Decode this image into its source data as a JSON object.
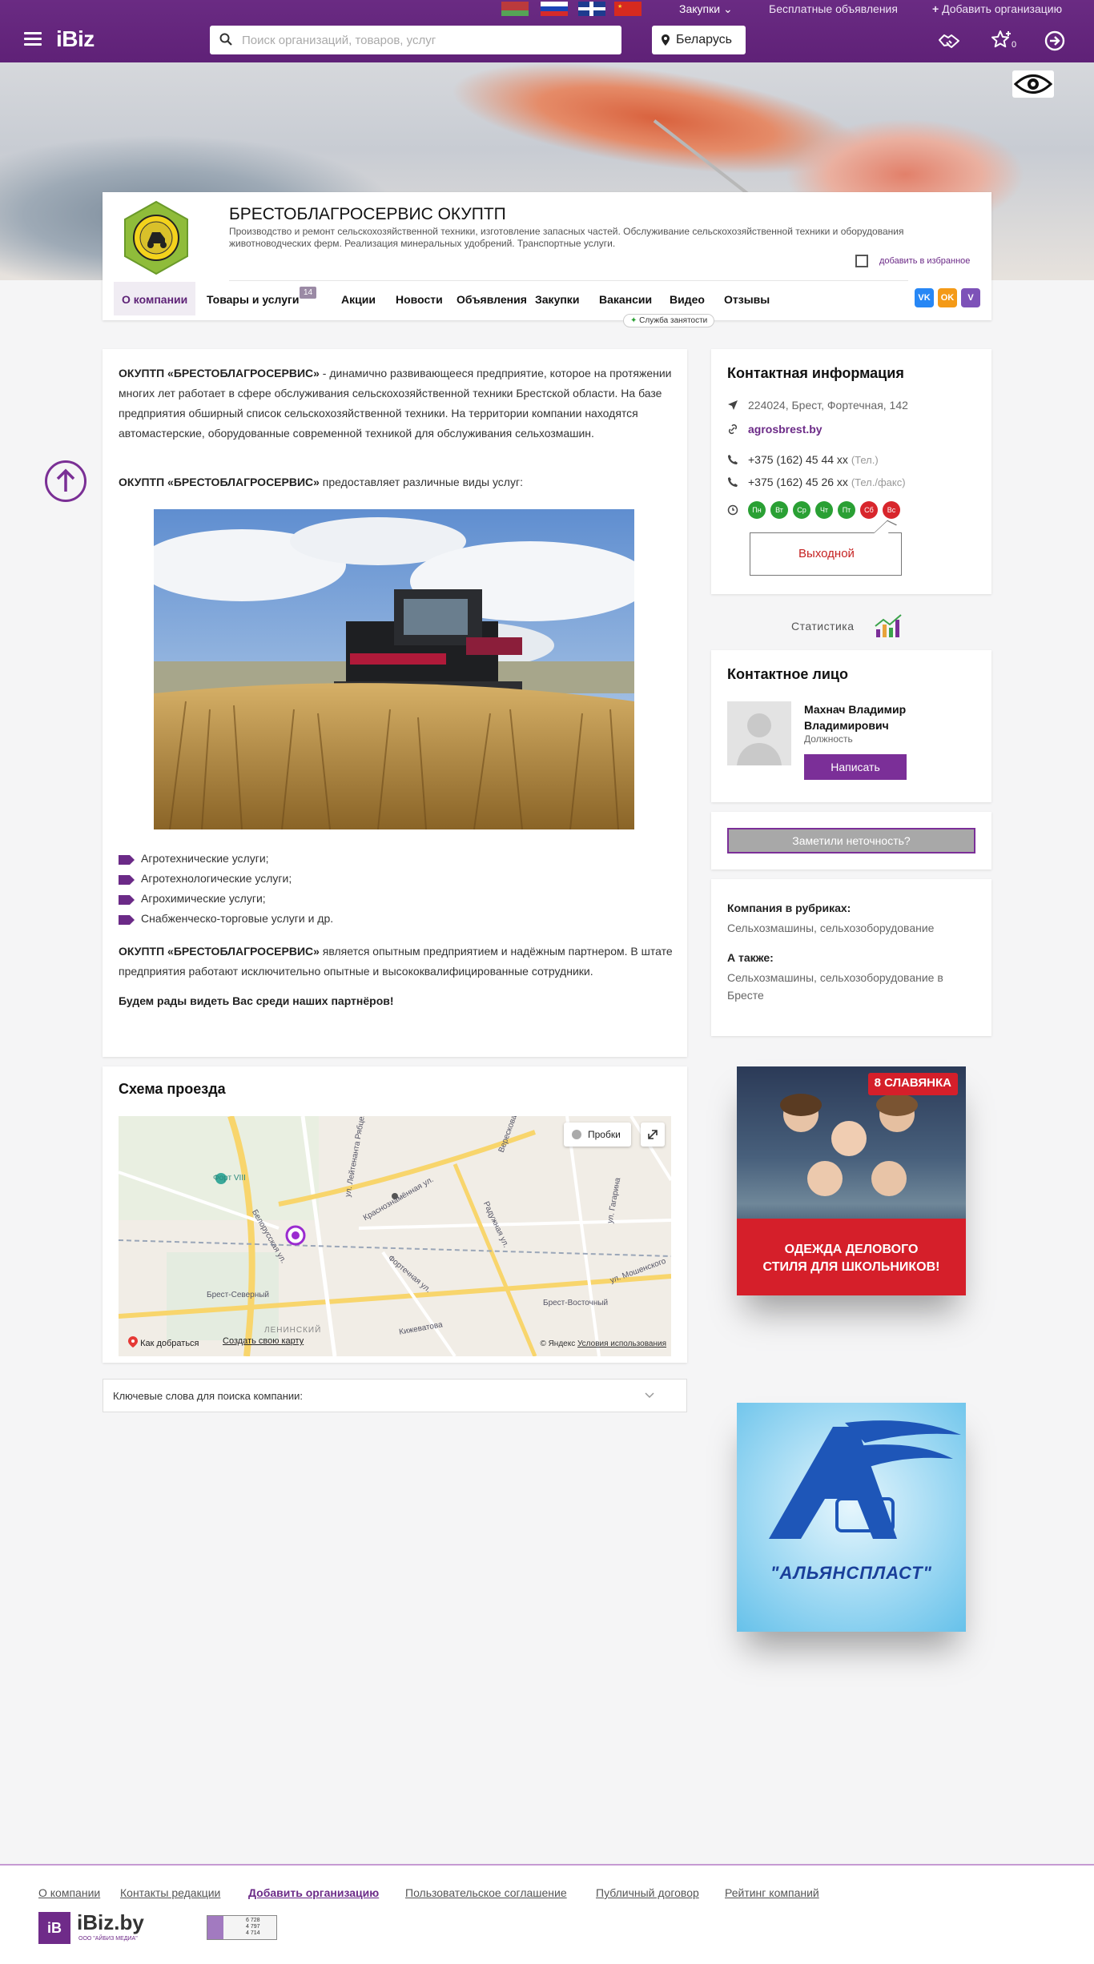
{
  "header": {
    "logo": "iBiz",
    "subnav": {
      "zakupki": "Закупки",
      "free_ads": "Бесплатные объявления",
      "add_org": "Добавить организацию"
    },
    "search_placeholder": "Поиск организаций, товаров, услуг",
    "country": "Беларусь",
    "favorites_count": "0"
  },
  "company": {
    "name": "БРЕСТОБЛАГРОСЕРВИС ОКУПТП",
    "description": "Производство и ремонт сельскохозяйственной техники, изготовление запасных частей. Обслуживание сельскохозяйственной техники и оборудования животноводческих ферм. Реализация минеральных удобрений. Транспортные услуги.",
    "favorite_label": "добавить в избранное",
    "tabs": [
      {
        "label": "О компании"
      },
      {
        "label": "Товары и услуги",
        "badge": "14"
      },
      {
        "label": "Акции"
      },
      {
        "label": "Новости"
      },
      {
        "label": "Объявления"
      },
      {
        "label": "Закупки"
      },
      {
        "label": "Вакансии"
      },
      {
        "label": "Видео"
      },
      {
        "label": "Отзывы"
      }
    ],
    "job_service": "Служба занятости",
    "social": {
      "vk": "VK",
      "ok": "OK",
      "viber": "V"
    }
  },
  "about": {
    "p1_bold": "ОКУПТП «БРЕСТОБЛАГРОСЕРВИС»",
    "p1_rest": " - динамично развивающееся предприятие, которое на протяжении многих лет работает в сфере обслуживания сельскохозяйственной техники Брестской области. На базе предприятия обширный список сельскохозяйственной техники. На территории компании находятся автомастерские, оборудованные современной техникой для обслуживания сельхозмашин.",
    "p2_bold": "ОКУПТП «БРЕСТОБЛАГРОСЕРВИС»",
    "p2_rest": " предоставляет различные виды услуг:",
    "services": [
      "Агротехнические услуги;",
      "Агротехнологические услуги;",
      "Агрохимические услуги;",
      "Снабженческо-торговые услуги и др."
    ],
    "p3_bold": "ОКУПТП «БРЕСТОБЛАГРОСЕРВИС»",
    "p3_rest": " является опытным предприятием и надёжным партнером. В штате предприятия работают исключительно опытные и высококвалифицированные сотрудники.",
    "p4": "Будем рады видеть Вас среди наших партнёров!"
  },
  "map": {
    "title": "Схема проезда",
    "traffic": "Пробки",
    "route": "Как добраться",
    "create_map": "Создать свою карту",
    "copyright": "© Яндекс",
    "terms": "Условия использования",
    "labels": [
      "Форт VIII",
      "Брест-Северный",
      "Брест-Восточный",
      "ЛЕНИНСКИЙ",
      "ул. Лейтенанта Рябцева",
      "Белорусская ул.",
      "Радужная ул.",
      "Фортечная ул.",
      "ул. Гагарина",
      "Кижеватова",
      "ул. Мошенского",
      "Краснознамённая ул.",
      "Вересковая"
    ]
  },
  "keywords": {
    "label": "Ключевые слова для поиска компании:"
  },
  "contacts": {
    "title": "Контактная информация",
    "address": "224024, Брест, Фортечная, 142",
    "site": "agrosbrest.by",
    "phone1": "+375 (162) 45 44 xx",
    "phone1_note": "(Тел.)",
    "phone2": "+375 (162) 45 26 xx",
    "phone2_note": "(Тел./факс)",
    "days": [
      {
        "d": "Пн",
        "open": true
      },
      {
        "d": "Вт",
        "open": true
      },
      {
        "d": "Ср",
        "open": true
      },
      {
        "d": "Чт",
        "open": true
      },
      {
        "d": "Пт",
        "open": true
      },
      {
        "d": "Сб",
        "open": false
      },
      {
        "d": "Вс",
        "open": false
      }
    ],
    "status": "Выходной"
  },
  "stats": {
    "label": "Статистика"
  },
  "person": {
    "title": "Контактное лицо",
    "name": "Махнач Владимир Владимирович",
    "role": "Должность",
    "write": "Написать"
  },
  "report": {
    "label": "Заметили неточность?"
  },
  "categories": {
    "heading": "Компания в рубриках:",
    "main": "Сельхозмашины, сельхозоборудование",
    "also_heading": "А также:",
    "also": "Сельхозмашины, сельхозоборудование в Бресте"
  },
  "ads": {
    "ad1_brand": "СЛАВЯНКА",
    "ad1_brand_num": "8",
    "ad1_line1": "ОДЕЖДА ДЕЛОВОГО",
    "ad1_line2": "СТИЛЯ ДЛЯ ШКОЛЬНИКОВ!",
    "ad2_name": "\"АЛЬЯНСПЛАСТ\""
  },
  "footer": {
    "links": [
      {
        "label": "О компании"
      },
      {
        "label": "Контакты редакции"
      },
      {
        "label": "Добавить организацию",
        "strong": true
      },
      {
        "label": "Пользовательское соглашение"
      },
      {
        "label": "Публичный договор"
      },
      {
        "label": "Рейтинг компаний"
      }
    ],
    "logo_mark": "iB",
    "logo_name": "iBiz.by",
    "logo_sub": "ООО \"АЙБИЗ МЕДИА\"",
    "counter": [
      "6 728",
      "4 797",
      "4 714"
    ]
  },
  "colors": {
    "brand": "#6a2b83",
    "accent_link": "#6b2a87",
    "open": "#2aa034",
    "closed": "#d8262c"
  }
}
